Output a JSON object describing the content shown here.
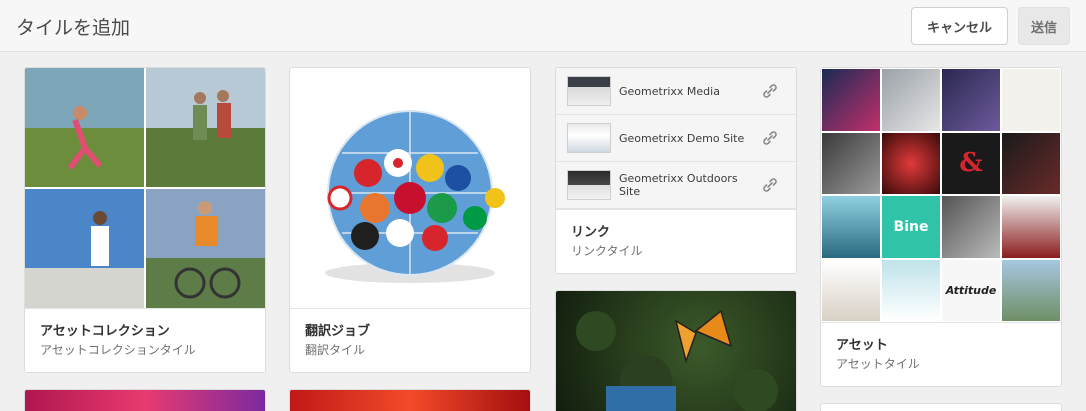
{
  "header": {
    "title": "タイルを追加",
    "cancel_label": "キャンセル",
    "send_label": "送信"
  },
  "tiles": {
    "asset_collection": {
      "title": "アセットコレクション",
      "subtitle": "アセットコレクションタイル"
    },
    "translation_job": {
      "title": "翻訳ジョブ",
      "subtitle": "翻訳タイル"
    },
    "links": {
      "title": "リンク",
      "subtitle": "リンクタイル",
      "items": [
        {
          "label": "Geometrixx Media",
          "icon": "link-icon"
        },
        {
          "label": "Geometrixx Demo Site",
          "icon": "link-icon"
        },
        {
          "label": "Geometrixx Outdoors Site",
          "icon": "link-icon"
        }
      ]
    },
    "assets": {
      "title": "アセット",
      "subtitle": "アセットタイル"
    }
  },
  "colors": {
    "accent_teal": "#2fc4a8",
    "adobe_red": "#d7262b"
  }
}
